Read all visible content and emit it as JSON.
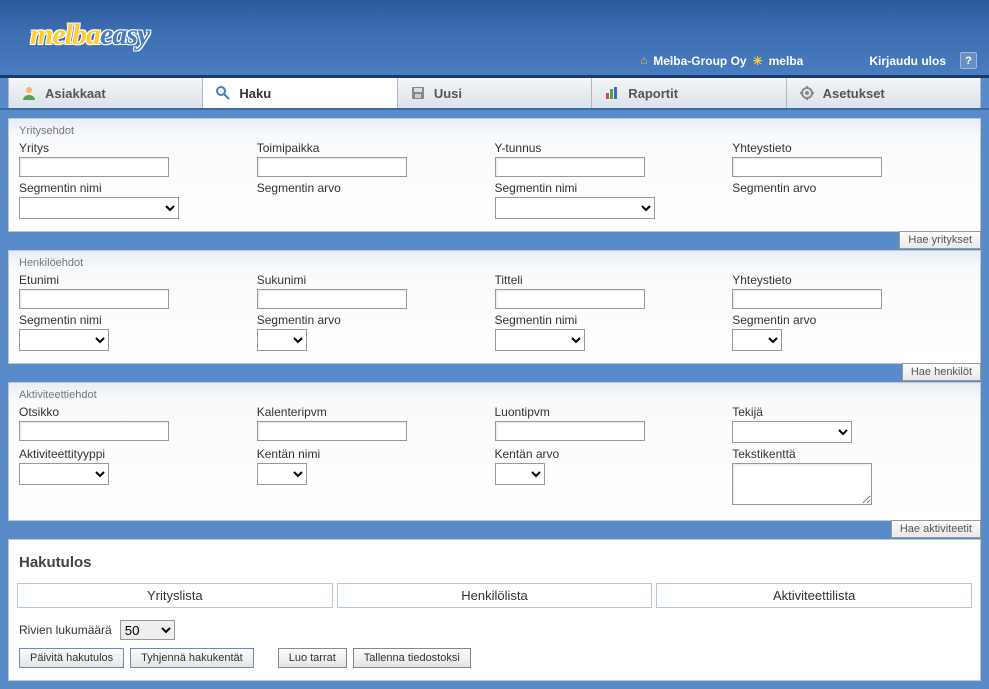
{
  "header": {
    "logo_part1": "melba",
    "logo_part2": "easy",
    "company": "Melba-Group Oy",
    "user": "melba",
    "logout": "Kirjaudu ulos"
  },
  "tabs": {
    "customers": "Asiakkaat",
    "search": "Haku",
    "new": "Uusi",
    "reports": "Raportit",
    "settings": "Asetukset"
  },
  "sections": {
    "company": {
      "title": "Yritysehdot",
      "fields": {
        "yritys": "Yritys",
        "toimipaikka": "Toimipaikka",
        "ytunnus": "Y-tunnus",
        "yhteystieto": "Yhteystieto",
        "seg_nimi": "Segmentin nimi",
        "seg_arvo": "Segmentin arvo"
      },
      "button": "Hae yritykset"
    },
    "person": {
      "title": "Henkilöehdot",
      "fields": {
        "etunimi": "Etunimi",
        "sukunimi": "Sukunimi",
        "titteli": "Titteli",
        "yhteystieto": "Yhteystieto",
        "seg_nimi": "Segmentin nimi",
        "seg_arvo": "Segmentin arvo"
      },
      "button": "Hae henkilöt"
    },
    "activity": {
      "title": "Aktiviteettiehdot",
      "fields": {
        "otsikko": "Otsikko",
        "kalenteripvm": "Kalenteripvm",
        "luontipvm": "Luontipvm",
        "tekija": "Tekijä",
        "tyyppi": "Aktiviteettityyppi",
        "kentan_nimi": "Kentän nimi",
        "kentan_arvo": "Kentän arvo",
        "tekstikentta": "Tekstikenttä"
      },
      "button": "Hae aktiviteetit"
    }
  },
  "results": {
    "title": "Hakutulos",
    "subtabs": {
      "yrityslista": "Yrityslista",
      "henkilolista": "Henkilölista",
      "aktiviteettilista": "Aktiviteettilista"
    },
    "rows_label": "Rivien lukumäärä",
    "rows_value": "50",
    "buttons": {
      "refresh": "Päivitä hakutulos",
      "clear": "Tyhjennä hakukentät",
      "labels": "Luo tarrat",
      "save": "Tallenna tiedostoksi"
    }
  }
}
